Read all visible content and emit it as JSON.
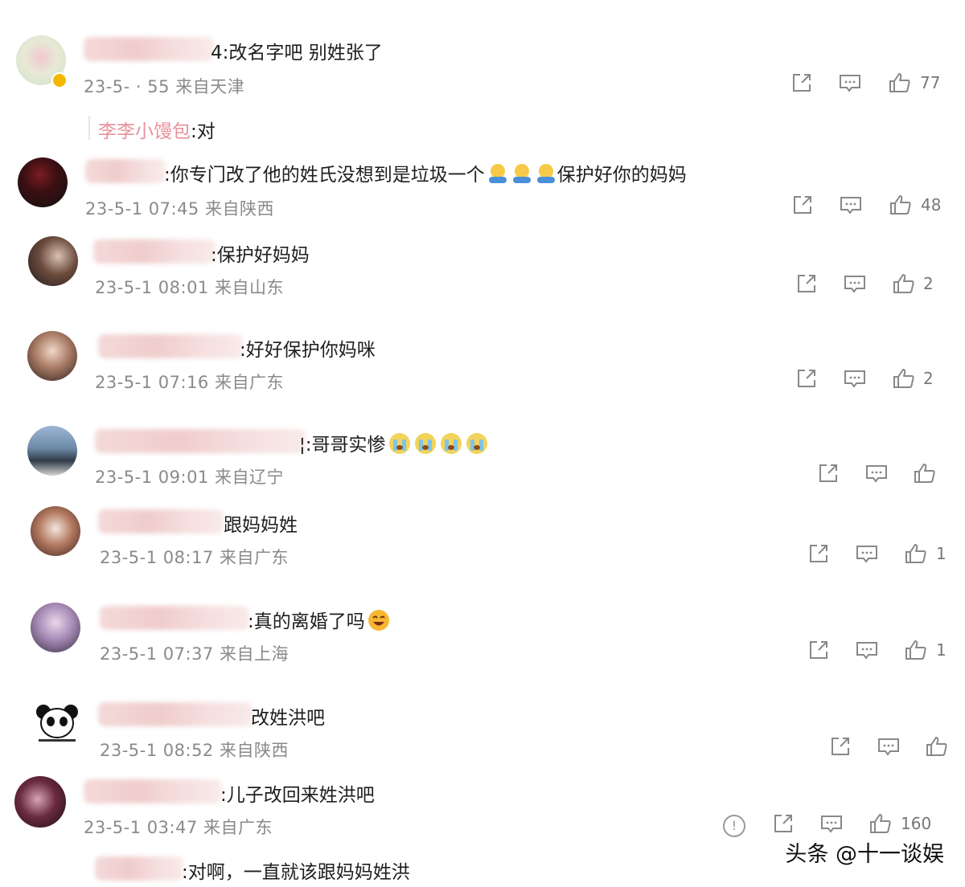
{
  "comments": [
    {
      "text": "4:改名字吧  别姓张了",
      "time": "23-5-  ·  55",
      "location": "来自天津",
      "likes": "77",
      "verified": true
    },
    {
      "text": ":你专门改了他的姓氏没想到是垃圾一个",
      "text_after": "保护好你的妈妈",
      "time": "23-5-1 07:45",
      "location": "来自陕西",
      "likes": "48"
    },
    {
      "text": ":保护好妈妈",
      "time": "23-5-1 08:01",
      "location": "来自山东",
      "likes": "2"
    },
    {
      "text": ":好好保护你妈咪",
      "time": "23-5-1 07:16",
      "location": "来自广东",
      "likes": "2"
    },
    {
      "text": "¦:哥哥实惨",
      "time": "23-5-1 09:01",
      "location": "来自辽宁",
      "likes": ""
    },
    {
      "text": "跟妈妈姓",
      "time": "23-5-1 08:17",
      "location": "来自广东",
      "likes": "1"
    },
    {
      "text": ":真的离婚了吗",
      "time": "23-5-1 07:37",
      "location": "来自上海",
      "likes": "1"
    },
    {
      "text": "改姓洪吧",
      "time": "23-5-1 08:52",
      "location": "来自陕西",
      "likes": ""
    },
    {
      "text": ":儿子改回来姓洪吧",
      "time": "23-5-1 03:47",
      "location": "来自广东",
      "likes": "160"
    }
  ],
  "reply": {
    "name": "李李小馒包",
    "text": ":对"
  },
  "bottom_reply": {
    "text": ":对啊，一直就该跟妈妈姓洪"
  },
  "watermark": "头条 @十一谈娱",
  "icons": {
    "share": "share-icon",
    "comment": "comment-icon",
    "like": "thumbs-up-icon",
    "report": "info-icon"
  },
  "colors": {
    "reply_name": "#e8919b",
    "meta": "#8a8a8a",
    "badge": "#f5b800"
  }
}
